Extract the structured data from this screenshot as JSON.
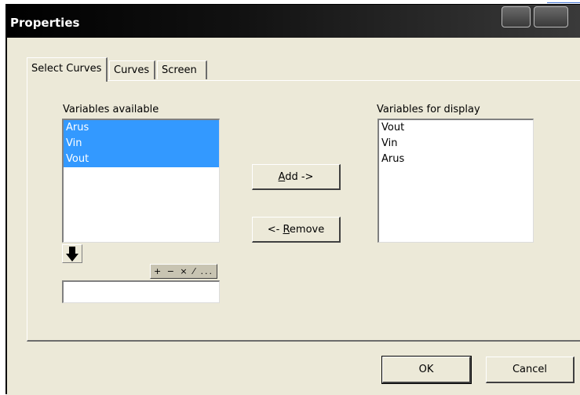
{
  "window": {
    "title": "Properties"
  },
  "tabs": [
    {
      "label": "Select Curves",
      "active": true
    },
    {
      "label": "Curves",
      "active": false
    },
    {
      "label": "Screen",
      "active": false
    }
  ],
  "available": {
    "label": "Variables available",
    "items": [
      "Arus",
      "Vin",
      "Vout"
    ]
  },
  "display": {
    "label": "Variables for display",
    "items": [
      "Vout",
      "Vin",
      "Arus"
    ]
  },
  "buttons": {
    "add_prefix": "",
    "add_mnemonic": "A",
    "add_rest": "dd ->",
    "remove_prefix": "<- ",
    "remove_mnemonic": "R",
    "remove_rest": "emove",
    "ok": "OK",
    "cancel": "Cancel"
  },
  "operators": "+ − × ⁄ ...",
  "expression_input": {
    "value": ""
  },
  "icons": {
    "insert": "down-arrow-icon"
  },
  "colors": {
    "selection": "#3399ff",
    "dialog_bg": "#ece9d8",
    "titlebar": "#000000"
  }
}
